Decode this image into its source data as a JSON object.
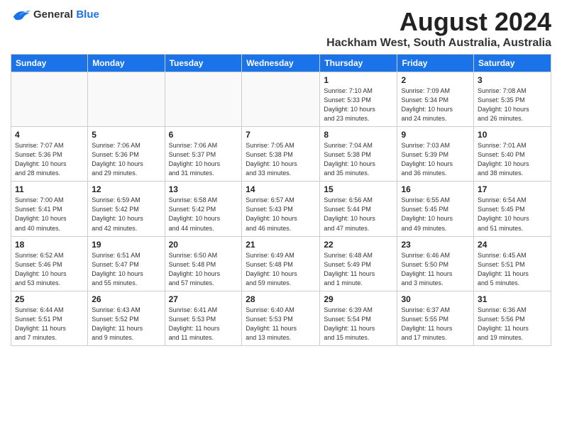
{
  "header": {
    "logo_general": "General",
    "logo_blue": "Blue",
    "main_title": "August 2024",
    "subtitle": "Hackham West, South Australia, Australia"
  },
  "days_of_week": [
    "Sunday",
    "Monday",
    "Tuesday",
    "Wednesday",
    "Thursday",
    "Friday",
    "Saturday"
  ],
  "weeks": [
    [
      {
        "date": "",
        "info": ""
      },
      {
        "date": "",
        "info": ""
      },
      {
        "date": "",
        "info": ""
      },
      {
        "date": "",
        "info": ""
      },
      {
        "date": "1",
        "info": "Sunrise: 7:10 AM\nSunset: 5:33 PM\nDaylight: 10 hours\nand 23 minutes."
      },
      {
        "date": "2",
        "info": "Sunrise: 7:09 AM\nSunset: 5:34 PM\nDaylight: 10 hours\nand 24 minutes."
      },
      {
        "date": "3",
        "info": "Sunrise: 7:08 AM\nSunset: 5:35 PM\nDaylight: 10 hours\nand 26 minutes."
      }
    ],
    [
      {
        "date": "4",
        "info": "Sunrise: 7:07 AM\nSunset: 5:36 PM\nDaylight: 10 hours\nand 28 minutes."
      },
      {
        "date": "5",
        "info": "Sunrise: 7:06 AM\nSunset: 5:36 PM\nDaylight: 10 hours\nand 29 minutes."
      },
      {
        "date": "6",
        "info": "Sunrise: 7:06 AM\nSunset: 5:37 PM\nDaylight: 10 hours\nand 31 minutes."
      },
      {
        "date": "7",
        "info": "Sunrise: 7:05 AM\nSunset: 5:38 PM\nDaylight: 10 hours\nand 33 minutes."
      },
      {
        "date": "8",
        "info": "Sunrise: 7:04 AM\nSunset: 5:38 PM\nDaylight: 10 hours\nand 35 minutes."
      },
      {
        "date": "9",
        "info": "Sunrise: 7:03 AM\nSunset: 5:39 PM\nDaylight: 10 hours\nand 36 minutes."
      },
      {
        "date": "10",
        "info": "Sunrise: 7:01 AM\nSunset: 5:40 PM\nDaylight: 10 hours\nand 38 minutes."
      }
    ],
    [
      {
        "date": "11",
        "info": "Sunrise: 7:00 AM\nSunset: 5:41 PM\nDaylight: 10 hours\nand 40 minutes."
      },
      {
        "date": "12",
        "info": "Sunrise: 6:59 AM\nSunset: 5:42 PM\nDaylight: 10 hours\nand 42 minutes."
      },
      {
        "date": "13",
        "info": "Sunrise: 6:58 AM\nSunset: 5:42 PM\nDaylight: 10 hours\nand 44 minutes."
      },
      {
        "date": "14",
        "info": "Sunrise: 6:57 AM\nSunset: 5:43 PM\nDaylight: 10 hours\nand 46 minutes."
      },
      {
        "date": "15",
        "info": "Sunrise: 6:56 AM\nSunset: 5:44 PM\nDaylight: 10 hours\nand 47 minutes."
      },
      {
        "date": "16",
        "info": "Sunrise: 6:55 AM\nSunset: 5:45 PM\nDaylight: 10 hours\nand 49 minutes."
      },
      {
        "date": "17",
        "info": "Sunrise: 6:54 AM\nSunset: 5:45 PM\nDaylight: 10 hours\nand 51 minutes."
      }
    ],
    [
      {
        "date": "18",
        "info": "Sunrise: 6:52 AM\nSunset: 5:46 PM\nDaylight: 10 hours\nand 53 minutes."
      },
      {
        "date": "19",
        "info": "Sunrise: 6:51 AM\nSunset: 5:47 PM\nDaylight: 10 hours\nand 55 minutes."
      },
      {
        "date": "20",
        "info": "Sunrise: 6:50 AM\nSunset: 5:48 PM\nDaylight: 10 hours\nand 57 minutes."
      },
      {
        "date": "21",
        "info": "Sunrise: 6:49 AM\nSunset: 5:48 PM\nDaylight: 10 hours\nand 59 minutes."
      },
      {
        "date": "22",
        "info": "Sunrise: 6:48 AM\nSunset: 5:49 PM\nDaylight: 11 hours\nand 1 minute."
      },
      {
        "date": "23",
        "info": "Sunrise: 6:46 AM\nSunset: 5:50 PM\nDaylight: 11 hours\nand 3 minutes."
      },
      {
        "date": "24",
        "info": "Sunrise: 6:45 AM\nSunset: 5:51 PM\nDaylight: 11 hours\nand 5 minutes."
      }
    ],
    [
      {
        "date": "25",
        "info": "Sunrise: 6:44 AM\nSunset: 5:51 PM\nDaylight: 11 hours\nand 7 minutes."
      },
      {
        "date": "26",
        "info": "Sunrise: 6:43 AM\nSunset: 5:52 PM\nDaylight: 11 hours\nand 9 minutes."
      },
      {
        "date": "27",
        "info": "Sunrise: 6:41 AM\nSunset: 5:53 PM\nDaylight: 11 hours\nand 11 minutes."
      },
      {
        "date": "28",
        "info": "Sunrise: 6:40 AM\nSunset: 5:53 PM\nDaylight: 11 hours\nand 13 minutes."
      },
      {
        "date": "29",
        "info": "Sunrise: 6:39 AM\nSunset: 5:54 PM\nDaylight: 11 hours\nand 15 minutes."
      },
      {
        "date": "30",
        "info": "Sunrise: 6:37 AM\nSunset: 5:55 PM\nDaylight: 11 hours\nand 17 minutes."
      },
      {
        "date": "31",
        "info": "Sunrise: 6:36 AM\nSunset: 5:56 PM\nDaylight: 11 hours\nand 19 minutes."
      }
    ]
  ]
}
